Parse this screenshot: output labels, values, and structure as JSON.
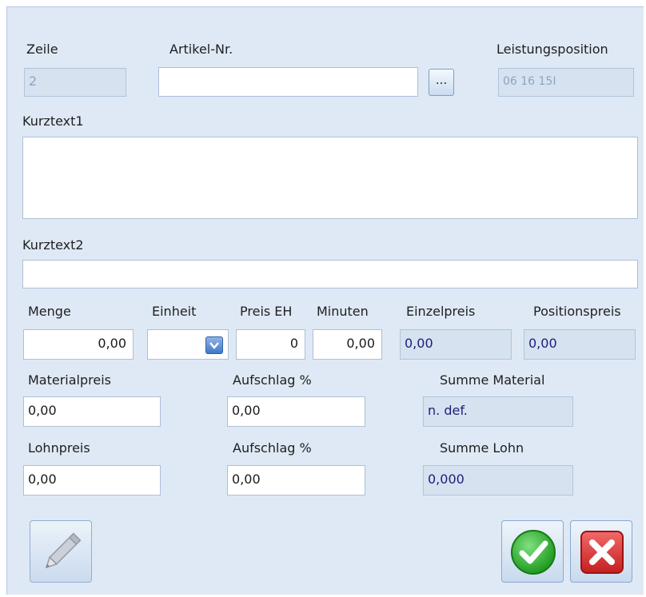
{
  "form": {
    "zeile": {
      "label": "Zeile",
      "value": "2"
    },
    "artikel": {
      "label": "Artikel-Nr.",
      "value": "",
      "browse_label": "..."
    },
    "leistungsposition": {
      "label": "Leistungsposition",
      "value": "06 16 15I"
    },
    "kurztext1": {
      "label": "Kurztext1",
      "value": ""
    },
    "kurztext2": {
      "label": "Kurztext2",
      "value": ""
    },
    "menge": {
      "label": "Menge",
      "value": "0,00"
    },
    "einheit": {
      "label": "Einheit",
      "value": ""
    },
    "preis_eh": {
      "label": "Preis EH",
      "value": "0"
    },
    "minuten": {
      "label": "Minuten",
      "value": "0,00"
    },
    "einzelpreis": {
      "label": "Einzelpreis",
      "value": "0,00"
    },
    "positionspreis": {
      "label": "Positionspreis",
      "value": "0,00"
    },
    "materialpreis": {
      "label": "Materialpreis",
      "value": "0,00"
    },
    "aufschlag_material": {
      "label": "Aufschlag %",
      "value": "0,00"
    },
    "summe_material": {
      "label": "Summe Material",
      "value": "n. def."
    },
    "lohnpreis": {
      "label": "Lohnpreis",
      "value": "0,00"
    },
    "aufschlag_lohn": {
      "label": "Aufschlag %",
      "value": "0,00"
    },
    "summe_lohn": {
      "label": "Summe Lohn",
      "value": "0,000"
    }
  },
  "buttons": {
    "edit_icon": "pencil-icon",
    "ok_icon": "checkmark-icon",
    "cancel_icon": "close-icon"
  },
  "colors": {
    "background": "#dfe9f5",
    "ok_green": "#2fb52f",
    "cancel_red": "#d92b2b"
  }
}
